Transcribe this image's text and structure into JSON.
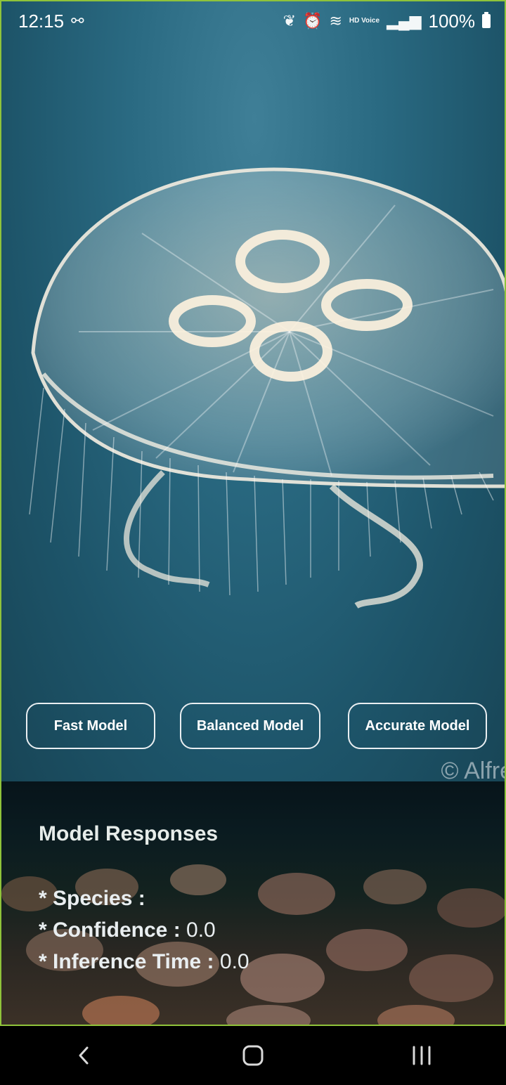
{
  "status_bar": {
    "time": "12:15",
    "battery": "100%",
    "hd_voice": "HD Voice",
    "icons": [
      "link-icon",
      "leaf-icon",
      "alarm-icon",
      "wifi-icon",
      "hd-voice-icon",
      "signal-icon",
      "battery-icon"
    ]
  },
  "image": {
    "watermark": "© Alfre"
  },
  "models": {
    "fast": "Fast Model",
    "balanced": "Balanced Model",
    "accurate": "Accurate Model"
  },
  "responses": {
    "title": "Model Responses",
    "species_label": "* Species :",
    "species_value": "",
    "confidence_label": "* Confidence :",
    "confidence_value": "0.0",
    "inference_label": "* Inference Time :",
    "inference_value": "0.0"
  },
  "colors": {
    "accent_border": "#8fc33a",
    "ocean": "#1d5469",
    "button_border": "#e9eef1"
  }
}
